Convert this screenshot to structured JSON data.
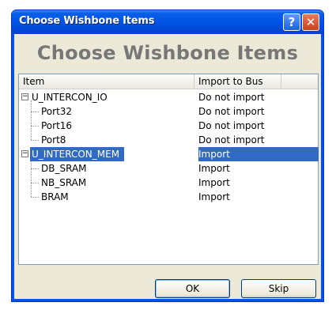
{
  "window": {
    "title": "Choose Wishbone Items",
    "help_glyph": "?",
    "close_glyph": "✕"
  },
  "banner": {
    "text": "Choose Wishbone Items"
  },
  "list": {
    "columns": [
      "Item",
      "Import to Bus"
    ],
    "rows": [
      {
        "item": "U_INTERCON_IO",
        "import": "Do not import",
        "level": 0,
        "expander": "−"
      },
      {
        "item": "Port32",
        "import": "Do not import",
        "level": 1
      },
      {
        "item": "Port16",
        "import": "Do not import",
        "level": 1
      },
      {
        "item": "Port8",
        "import": "Do not import",
        "level": 1
      },
      {
        "item": "U_INTERCON_MEM",
        "import": "Import",
        "level": 0,
        "expander": "−",
        "selected": true
      },
      {
        "item": "DB_SRAM",
        "import": "Import",
        "level": 1
      },
      {
        "item": "NB_SRAM",
        "import": "Import",
        "level": 1
      },
      {
        "item": "BRAM",
        "import": "Import",
        "level": 1
      }
    ]
  },
  "buttons": {
    "ok_label": "OK",
    "skip_label": "Skip"
  },
  "colors": {
    "titlebar": "#0055e5",
    "selection": "#316ac5",
    "dialog_bg": "#ece9d8"
  }
}
